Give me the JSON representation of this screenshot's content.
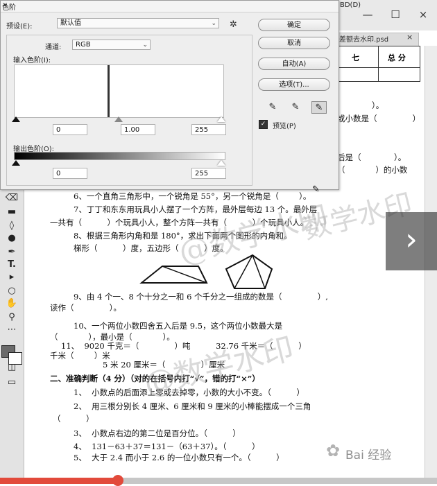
{
  "app": {
    "menu_fragment": "BD(D)",
    "tab_fragment": "差额去水印.psd",
    "tab_close": "×",
    "window_controls": [
      "—",
      "☐",
      "×"
    ],
    "tools": [
      "eraser-icon",
      "gradient-icon",
      "blur-icon",
      "dodge-icon",
      "pen-icon",
      "text-tool-icon",
      "path-select-icon",
      "ellipse-icon",
      "hand-icon",
      "zoom-icon",
      "more-icon"
    ],
    "text_tool_glyph": "T.",
    "nav_arrow": "›"
  },
  "progress": {
    "fraction": 0.27,
    "color": "#e24a3b"
  },
  "dialog": {
    "title": "色阶",
    "close": "×",
    "preset_label": "预设(E):",
    "preset_value": "默认值",
    "channel_label": "通道:",
    "channel_value": "RGB",
    "input_levels_label": "输入色阶(I):",
    "input_black": "0",
    "input_gamma": "1.00",
    "input_white": "255",
    "output_levels_label": "输出色阶(O):",
    "output_black": "0",
    "output_white": "255",
    "buttons": {
      "ok": "确定",
      "cancel": "取消",
      "auto": "自动(A)",
      "options": "选项(T)..."
    },
    "preview_label": "预览(P)",
    "preview_checked": true
  },
  "exam": {
    "table_headers": [
      "七",
      "总 分"
    ],
    "lines": [
      "）。",
      "或小数是（              ）",
      "后是（             ）。",
      "（            ）的小数",
      "6、一个直角三角形中，一个锐角是 55°，另一个锐角是（        ）。",
      "7、丁丁和东东用玩具小人摆了一个方阵，最外层每边 13 个。最外层",
      "一共有（          ）个玩具小人，整个方阵一共有（          ）个玩具小人。",
      "8、根据三角形内角和是 180°，求出下面两个图形的内角和。",
      "梯形（          ）度，五边形（          ）度。",
      "9、由 4 个一、8 个十分之一和 6 个千分之一组成的数是（              ）,",
      "读作（              ）。",
      "10、一个两位小数四舍五入后是 9.5，这个两位小数最大是",
      "（            ），最小是（            ）。",
      "11、  9020 千克＝（              ）吨          32.76 千米＝（          ）",
      "千米（        ）米",
      "5 米 20 厘米＝（              ）厘米",
      "二、准确判断（4 分）（对的在括号内打“√”，错的打“×”）",
      "1、  小数点的后面添上零或去掉零，小数的大小不变。（          ）",
      "2、  用三根分别长 4 厘米、6 厘米和 9 厘米的小棒能摆成一个三角",
      "（          ）",
      "3、  小数点右边的第二位是百分位。（          ）",
      "4、  131－63＋37＝131－（63＋37）。（          ）",
      "5、  大于 2.4 而小于 2.6 的一位小数只有一个。（          ）"
    ],
    "watermarks": [
      "@数学水印",
      "@数学水印",
      "数学水印"
    ],
    "baidu_logo": "Bai 经验"
  }
}
